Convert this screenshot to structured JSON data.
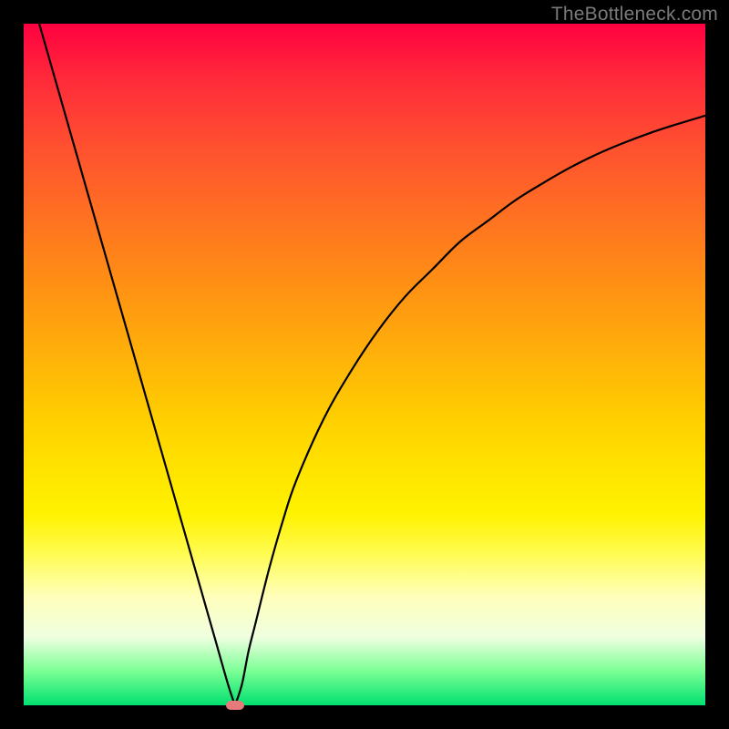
{
  "watermark": "TheBottleneck.com",
  "chart_data": {
    "type": "line",
    "title": "",
    "xlabel": "",
    "ylabel": "",
    "xlim": [
      0,
      100
    ],
    "ylim": [
      0,
      100
    ],
    "series": [
      {
        "name": "bottleneck-curve",
        "x": [
          0,
          2,
          4,
          6,
          8,
          10,
          12,
          14,
          16,
          18,
          20,
          22,
          24,
          26,
          28,
          30,
          31,
          32,
          33,
          34,
          36,
          38,
          40,
          44,
          48,
          52,
          56,
          60,
          64,
          68,
          72,
          76,
          80,
          84,
          88,
          92,
          96,
          100
        ],
        "values": [
          108,
          101,
          94,
          87,
          80,
          73,
          66,
          59,
          52,
          45,
          38,
          31,
          24,
          17,
          10,
          3,
          0,
          3,
          8,
          12,
          20,
          27,
          33,
          42,
          49,
          55,
          60,
          64,
          68,
          71,
          74,
          76.5,
          78.8,
          80.8,
          82.5,
          84,
          85.3,
          86.5
        ]
      }
    ],
    "marker": {
      "x": 31,
      "y": 0,
      "color": "#e67a7a"
    },
    "background_gradient": [
      "#ff0040",
      "#ff8f14",
      "#ffe500",
      "#ffffbb",
      "#00e070"
    ]
  }
}
